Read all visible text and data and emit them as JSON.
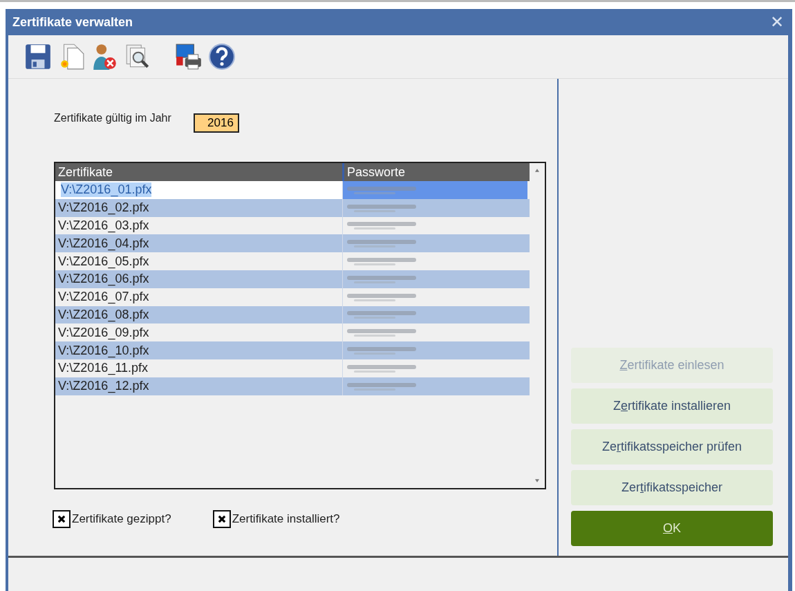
{
  "window": {
    "title": "Zertifikate verwalten",
    "close": "✕"
  },
  "toolbar": [
    {
      "kind": "save"
    },
    {
      "kind": "new"
    },
    {
      "kind": "user-remove"
    },
    {
      "kind": "preview"
    },
    {
      "kind": "print"
    },
    {
      "kind": "help"
    }
  ],
  "year": {
    "label": "Zertifikate gültig im Jahr",
    "value": "2016"
  },
  "table": {
    "columns": [
      "Zertifikate",
      "Passworte"
    ],
    "rows": [
      {
        "file": "V:\\Z2016_01.pfx",
        "selected": true
      },
      {
        "file": "V:\\Z2016_02.pfx",
        "selected": false
      },
      {
        "file": "V:\\Z2016_03.pfx",
        "selected": false
      },
      {
        "file": "V:\\Z2016_04.pfx",
        "selected": false
      },
      {
        "file": "V:\\Z2016_05.pfx",
        "selected": false
      },
      {
        "file": "V:\\Z2016_06.pfx",
        "selected": false
      },
      {
        "file": "V:\\Z2016_07.pfx",
        "selected": false
      },
      {
        "file": "V:\\Z2016_08.pfx",
        "selected": false
      },
      {
        "file": "V:\\Z2016_09.pfx",
        "selected": false
      },
      {
        "file": "V:\\Z2016_10.pfx",
        "selected": false
      },
      {
        "file": "V:\\Z2016_11.pfx",
        "selected": false
      },
      {
        "file": "V:\\Z2016_12.pfx",
        "selected": false
      }
    ]
  },
  "checkboxes": [
    {
      "label": "Zertifikate gezippt?",
      "checked": true
    },
    {
      "label": "Zertifikate installiert?",
      "checked": true
    }
  ],
  "buttons": [
    {
      "key": "Z",
      "after": "ertifikate einlesen",
      "kind": "normal",
      "disabled": true
    },
    {
      "before": "Z",
      "key": "e",
      "after": "rtifikate installieren",
      "kind": "normal",
      "disabled": false
    },
    {
      "before": "Ze",
      "key": "r",
      "after": "tifikatsspeicher prüfen",
      "kind": "normal",
      "disabled": false
    },
    {
      "before": "Zer",
      "key": "t",
      "after": "ifikatsspeicher",
      "kind": "normal",
      "disabled": false
    },
    {
      "key": "O",
      "after": "K",
      "kind": "default",
      "disabled": false
    }
  ]
}
